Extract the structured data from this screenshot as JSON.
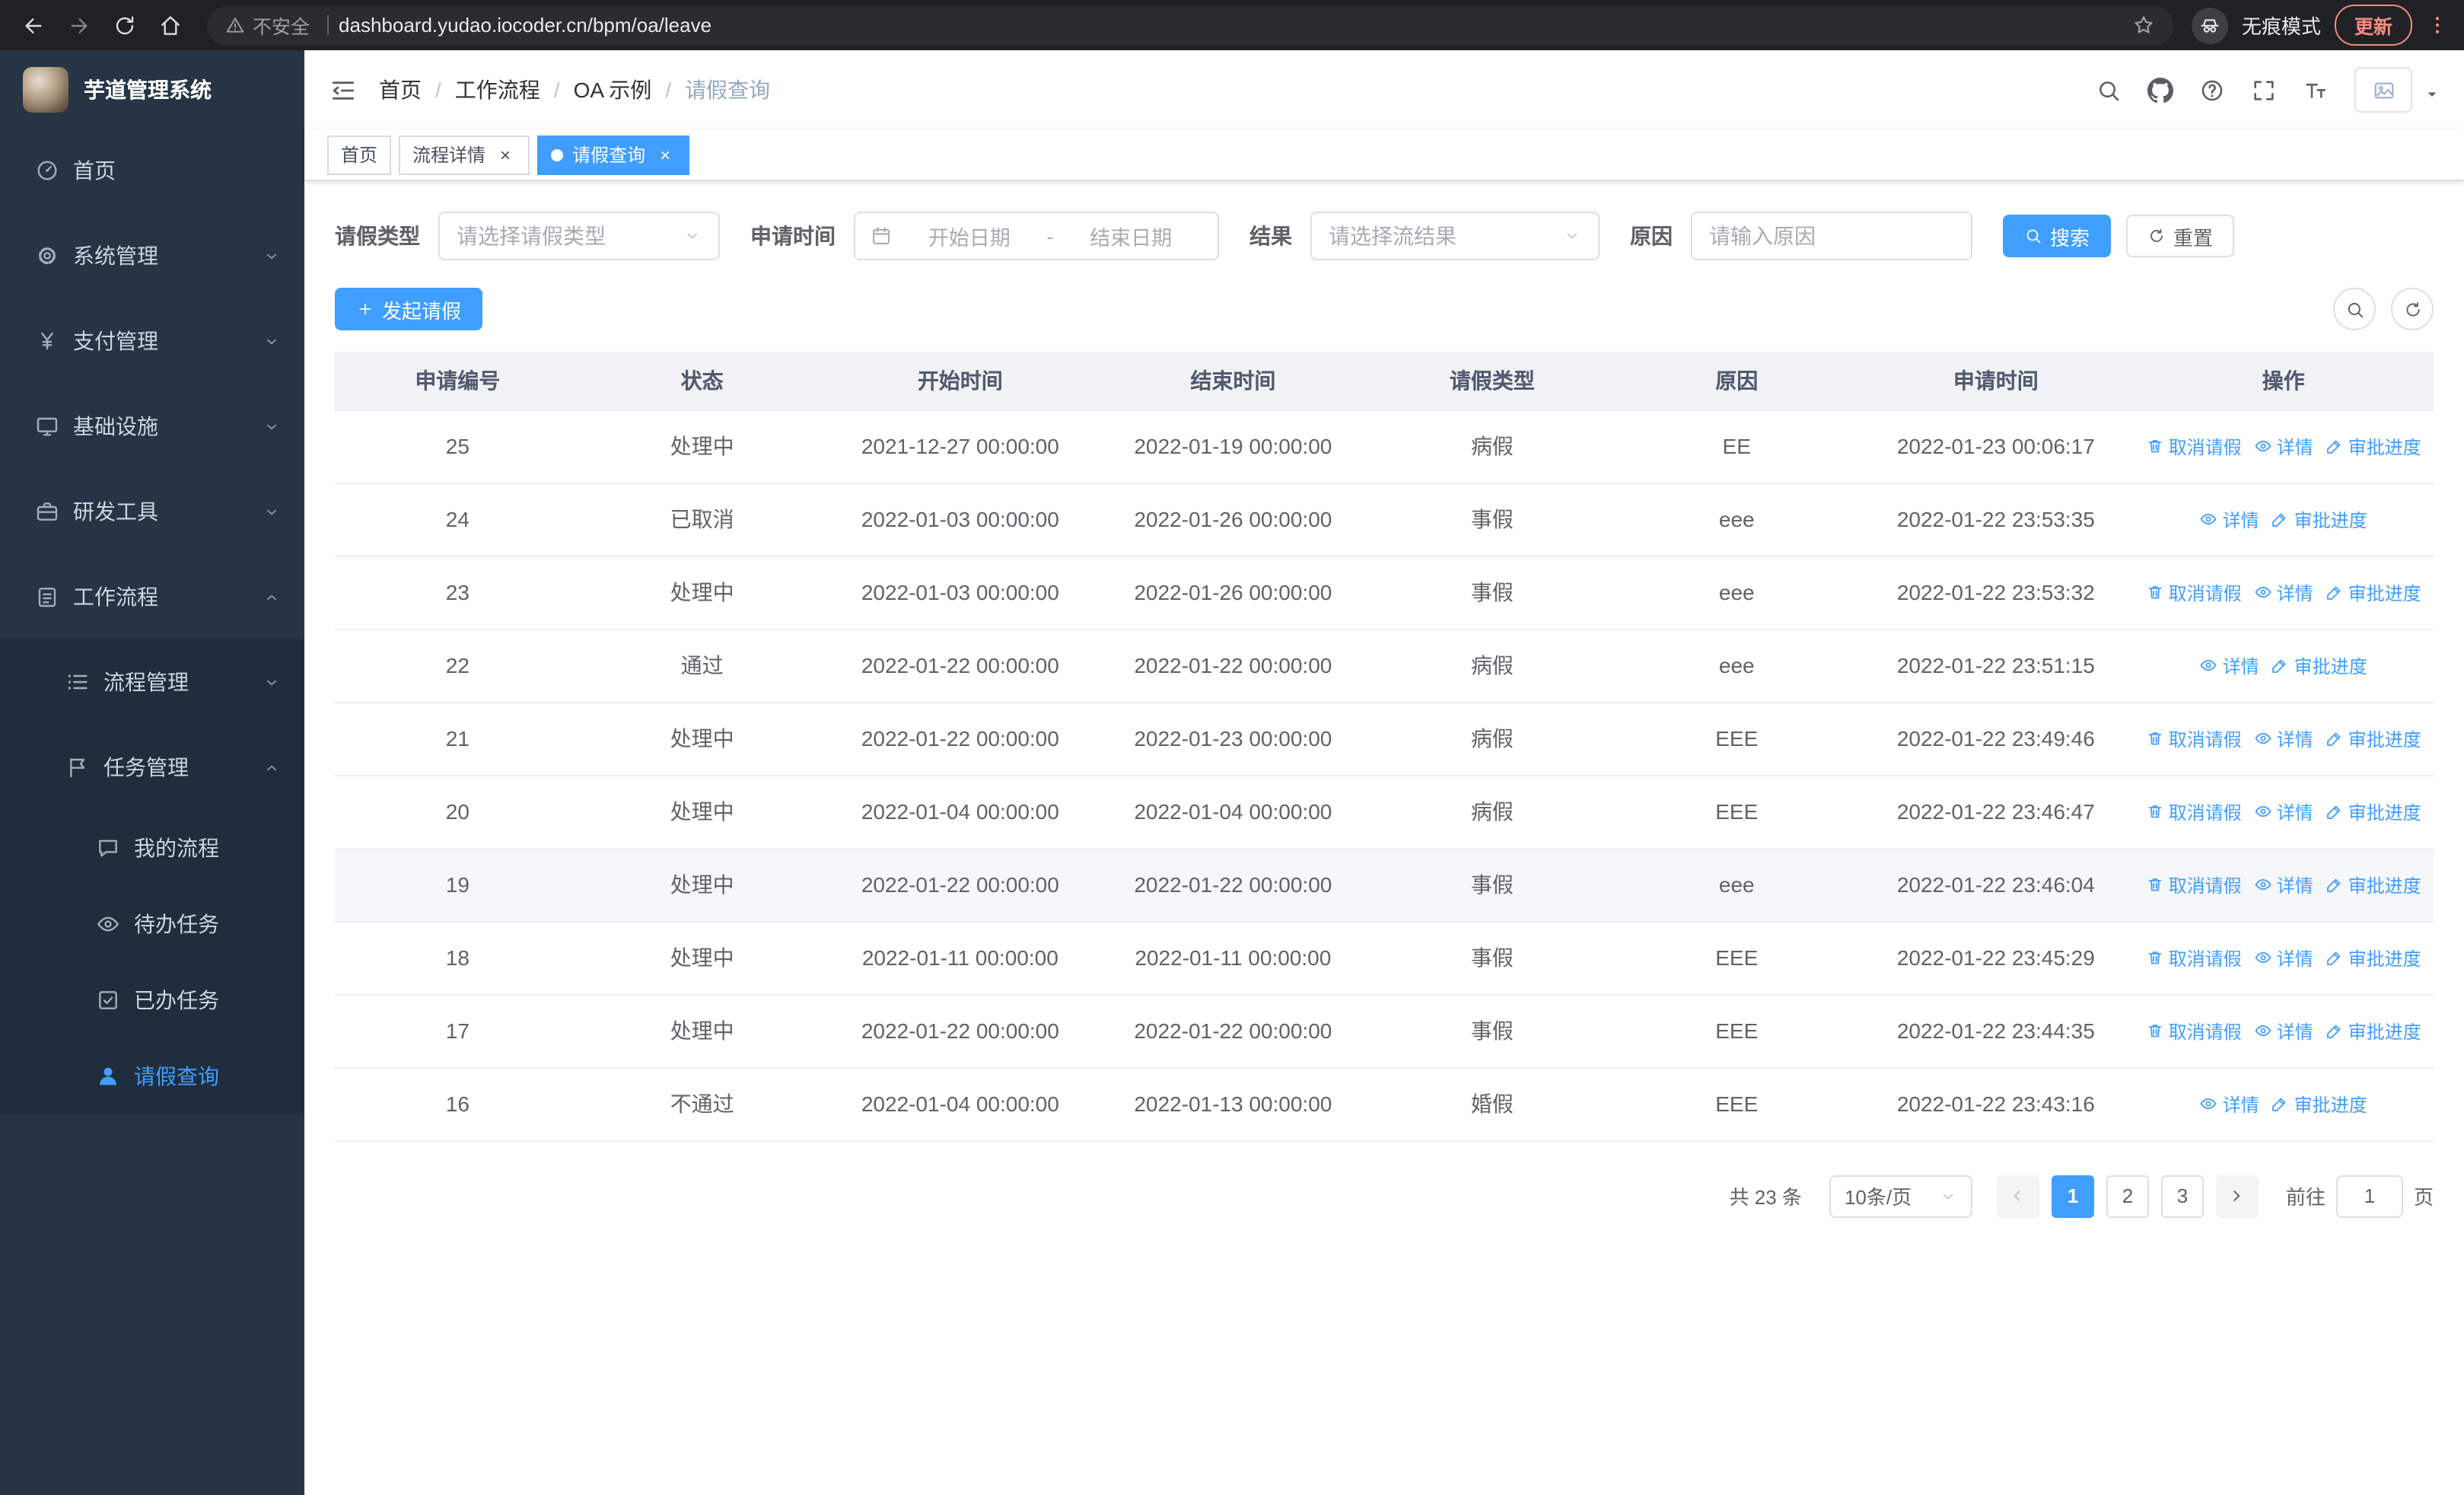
{
  "colors": {
    "accent": "#409eff",
    "sidebar_bg": "#263445",
    "sidebar_submenu_bg": "#1f2d3d"
  },
  "browser": {
    "nav_icons": [
      "back",
      "forward",
      "reload",
      "home"
    ],
    "security_warning": "不安全",
    "url": "dashboard.yudao.iocoder.cn/bpm/oa/leave",
    "incognito_label": "无痕模式",
    "update_button": "更新"
  },
  "sidebar": {
    "logo_title": "芋道管理系统",
    "menu": [
      {
        "key": "home",
        "label": "首页",
        "icon": "dashboard"
      },
      {
        "key": "system",
        "label": "系统管理",
        "icon": "gear",
        "arrow": "down"
      },
      {
        "key": "payment",
        "label": "支付管理",
        "icon": "yen",
        "arrow": "down"
      },
      {
        "key": "infrastructure",
        "label": "基础设施",
        "icon": "monitor",
        "arrow": "down"
      },
      {
        "key": "dev-tools",
        "label": "研发工具",
        "icon": "toolbox",
        "arrow": "down"
      },
      {
        "key": "workflow",
        "label": "工作流程",
        "icon": "clipboard",
        "arrow": "up",
        "children": [
          {
            "key": "process-mgmt",
            "label": "流程管理",
            "icon": "list",
            "arrow": "down"
          },
          {
            "key": "task-mgmt",
            "label": "任务管理",
            "icon": "flag",
            "arrow": "up",
            "children": [
              {
                "key": "my-process",
                "label": "我的流程",
                "icon": "chat"
              },
              {
                "key": "todo-tasks",
                "label": "待办任务",
                "icon": "eye"
              },
              {
                "key": "done-tasks",
                "label": "已办任务",
                "icon": "check"
              },
              {
                "key": "leave-query",
                "label": "请假查询",
                "icon": "user",
                "active": true
              }
            ]
          }
        ]
      }
    ]
  },
  "header": {
    "breadcrumb": [
      "首页",
      "工作流程",
      "OA 示例",
      "请假查询"
    ],
    "action_icons": [
      "search",
      "github",
      "question",
      "fullscreen",
      "fontsize"
    ]
  },
  "tabs": [
    {
      "key": "home",
      "label": "首页",
      "closable": false,
      "active": false
    },
    {
      "key": "process-detail",
      "label": "流程详情",
      "closable": true,
      "active": false
    },
    {
      "key": "leave-query",
      "label": "请假查询",
      "closable": true,
      "active": true
    }
  ],
  "filters": {
    "leave_type_label": "请假类型",
    "leave_type_placeholder": "请选择请假类型",
    "apply_time_label": "申请时间",
    "start_date_placeholder": "开始日期",
    "date_separator": "-",
    "end_date_placeholder": "结束日期",
    "result_label": "结果",
    "result_placeholder": "请选择流结果",
    "reason_label": "原因",
    "reason_placeholder": "请输入原因",
    "search_button": "搜索",
    "reset_button": "重置"
  },
  "toolbar": {
    "create_button": "发起请假"
  },
  "table": {
    "columns": [
      "申请编号",
      "状态",
      "开始时间",
      "结束时间",
      "请假类型",
      "原因",
      "申请时间",
      "操作"
    ],
    "action_defs": {
      "cancel": {
        "label": "取消请假",
        "icon": "trash"
      },
      "detail": {
        "label": "详情",
        "icon": "eye"
      },
      "progress": {
        "label": "审批进度",
        "icon": "edit"
      }
    },
    "rows": [
      {
        "id": "25",
        "status": "处理中",
        "start": "2021-12-27 00:00:00",
        "end": "2022-01-19 00:00:00",
        "type": "病假",
        "reason": "EE",
        "applied": "2022-01-23 00:06:17",
        "actions": [
          "cancel",
          "detail",
          "progress"
        ]
      },
      {
        "id": "24",
        "status": "已取消",
        "start": "2022-01-03 00:00:00",
        "end": "2022-01-26 00:00:00",
        "type": "事假",
        "reason": "eee",
        "applied": "2022-01-22 23:53:35",
        "actions": [
          "detail",
          "progress"
        ]
      },
      {
        "id": "23",
        "status": "处理中",
        "start": "2022-01-03 00:00:00",
        "end": "2022-01-26 00:00:00",
        "type": "事假",
        "reason": "eee",
        "applied": "2022-01-22 23:53:32",
        "actions": [
          "cancel",
          "detail",
          "progress"
        ]
      },
      {
        "id": "22",
        "status": "通过",
        "start": "2022-01-22 00:00:00",
        "end": "2022-01-22 00:00:00",
        "type": "病假",
        "reason": "eee",
        "applied": "2022-01-22 23:51:15",
        "actions": [
          "detail",
          "progress"
        ]
      },
      {
        "id": "21",
        "status": "处理中",
        "start": "2022-01-22 00:00:00",
        "end": "2022-01-23 00:00:00",
        "type": "病假",
        "reason": "EEE",
        "applied": "2022-01-22 23:49:46",
        "actions": [
          "cancel",
          "detail",
          "progress"
        ]
      },
      {
        "id": "20",
        "status": "处理中",
        "start": "2022-01-04 00:00:00",
        "end": "2022-01-04 00:00:00",
        "type": "病假",
        "reason": "EEE",
        "applied": "2022-01-22 23:46:47",
        "actions": [
          "cancel",
          "detail",
          "progress"
        ]
      },
      {
        "id": "19",
        "status": "处理中",
        "start": "2022-01-22 00:00:00",
        "end": "2022-01-22 00:00:00",
        "type": "事假",
        "reason": "eee",
        "applied": "2022-01-22 23:46:04",
        "actions": [
          "cancel",
          "detail",
          "progress"
        ],
        "highlighted": true
      },
      {
        "id": "18",
        "status": "处理中",
        "start": "2022-01-11 00:00:00",
        "end": "2022-01-11 00:00:00",
        "type": "事假",
        "reason": "EEE",
        "applied": "2022-01-22 23:45:29",
        "actions": [
          "cancel",
          "detail",
          "progress"
        ]
      },
      {
        "id": "17",
        "status": "处理中",
        "start": "2022-01-22 00:00:00",
        "end": "2022-01-22 00:00:00",
        "type": "事假",
        "reason": "EEE",
        "applied": "2022-01-22 23:44:35",
        "actions": [
          "cancel",
          "detail",
          "progress"
        ]
      },
      {
        "id": "16",
        "status": "不通过",
        "start": "2022-01-04 00:00:00",
        "end": "2022-01-13 00:00:00",
        "type": "婚假",
        "reason": "EEE",
        "applied": "2022-01-22 23:43:16",
        "actions": [
          "detail",
          "progress"
        ]
      }
    ]
  },
  "pagination": {
    "total_text": "共 23 条",
    "page_size": "10条/页",
    "pages": [
      "1",
      "2",
      "3"
    ],
    "active_page": "1",
    "goto_label": "前往",
    "goto_value": "1",
    "goto_suffix": "页"
  }
}
